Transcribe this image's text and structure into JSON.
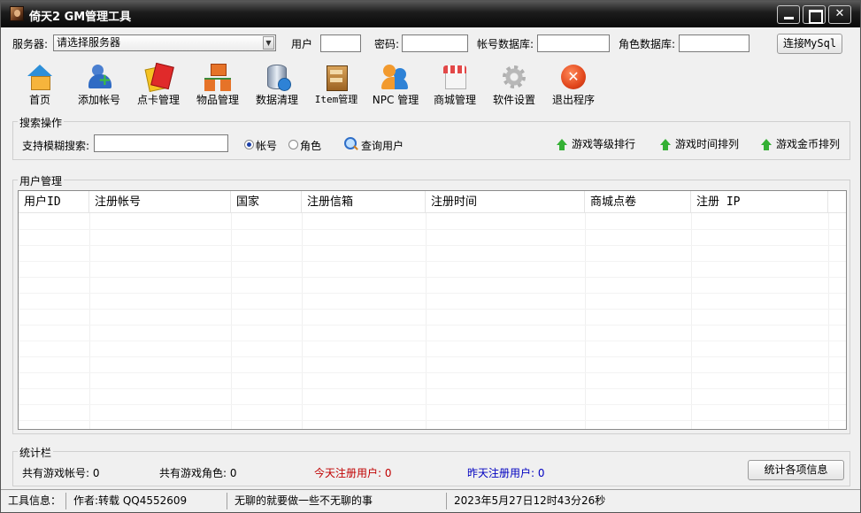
{
  "window": {
    "title": "倚天2 GM管理工具",
    "controls": [
      "minimize",
      "maximize",
      "close"
    ]
  },
  "connection": {
    "server_label": "服务器:",
    "server_value": "请选择服务器",
    "user_label": "用户",
    "user_value": "",
    "password_label": "密码:",
    "password_value": "",
    "account_db_label": "帐号数据库:",
    "account_db_value": "",
    "role_db_label": "角色数据库:",
    "role_db_value": "",
    "connect_button": "连接MySql"
  },
  "toolbar": [
    {
      "label": "首页",
      "icon": "home-icon"
    },
    {
      "label": "添加帐号",
      "icon": "add-user-icon"
    },
    {
      "label": "点卡管理",
      "icon": "card-icon"
    },
    {
      "label": "物品管理",
      "icon": "items-icon"
    },
    {
      "label": "数据清理",
      "icon": "database-icon"
    },
    {
      "label": "Item管理",
      "icon": "item-box-icon"
    },
    {
      "label": "NPC 管理",
      "icon": "npc-icon"
    },
    {
      "label": "商城管理",
      "icon": "shop-icon"
    },
    {
      "label": "软件设置",
      "icon": "gear-icon"
    },
    {
      "label": "退出程序",
      "icon": "exit-icon"
    }
  ],
  "search": {
    "group_title": "搜索操作",
    "fuzzy_label": "支持模糊搜索:",
    "fuzzy_value": "",
    "radio_account": "帐号",
    "radio_role": "角色",
    "selected": "帐号",
    "query_button": "查询用户",
    "rank_level": "游戏等级排行",
    "rank_time": "游戏时间排列",
    "rank_gold": "游戏金币排列"
  },
  "users": {
    "group_title": "用户管理",
    "columns": [
      "用户ID",
      "注册帐号",
      "国家",
      "注册信箱",
      "注册时间",
      "商城点卷",
      "注册 IP"
    ],
    "rows": []
  },
  "stats": {
    "group_title": "统计栏",
    "total_accounts": "共有游戏帐号: 0",
    "total_roles": "共有游戏角色: 0",
    "today_registered": "今天注册用户: 0",
    "yesterday_registered": "昨天注册用户: 0",
    "today_color": "#c00000",
    "yesterday_color": "#0000c0",
    "stats_button": "统计各项信息"
  },
  "statusbar": {
    "tool_info": "工具信息：",
    "author": "作者:转载 QQ4552609",
    "motto": "无聊的就要做一些不无聊的事",
    "datetime": "2023年5月27日12时43分26秒"
  }
}
